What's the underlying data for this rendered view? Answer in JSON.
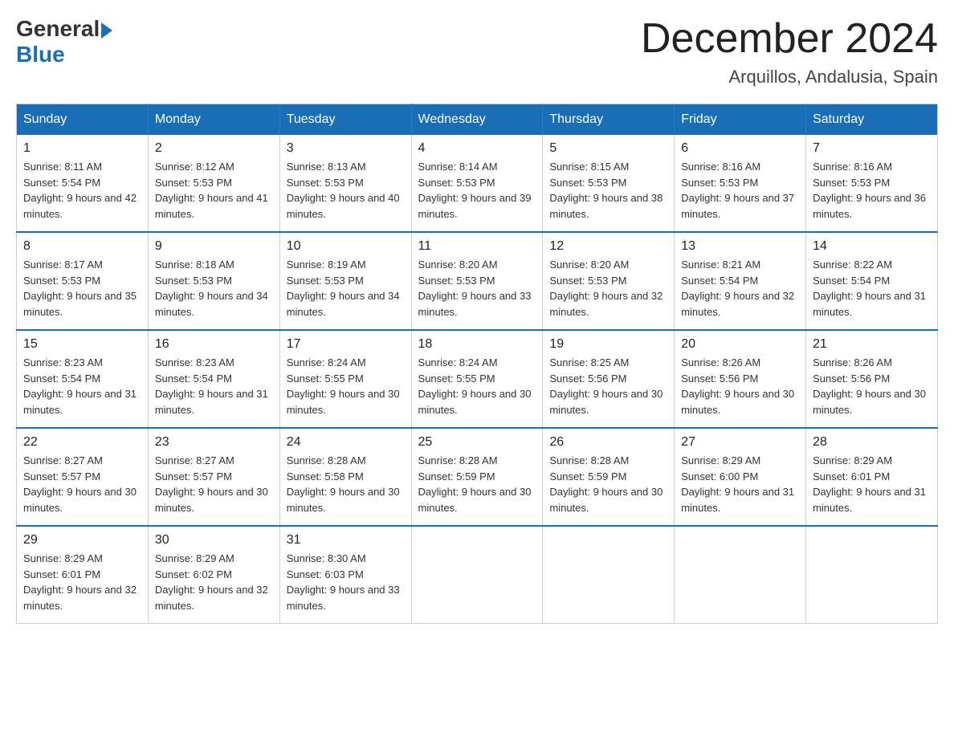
{
  "logo": {
    "general": "General",
    "blue": "Blue"
  },
  "title": {
    "month": "December 2024",
    "location": "Arquillos, Andalusia, Spain"
  },
  "weekdays": [
    "Sunday",
    "Monday",
    "Tuesday",
    "Wednesday",
    "Thursday",
    "Friday",
    "Saturday"
  ],
  "weeks": [
    [
      {
        "day": "1",
        "sunrise": "8:11 AM",
        "sunset": "5:54 PM",
        "daylight": "9 hours and 42 minutes."
      },
      {
        "day": "2",
        "sunrise": "8:12 AM",
        "sunset": "5:53 PM",
        "daylight": "9 hours and 41 minutes."
      },
      {
        "day": "3",
        "sunrise": "8:13 AM",
        "sunset": "5:53 PM",
        "daylight": "9 hours and 40 minutes."
      },
      {
        "day": "4",
        "sunrise": "8:14 AM",
        "sunset": "5:53 PM",
        "daylight": "9 hours and 39 minutes."
      },
      {
        "day": "5",
        "sunrise": "8:15 AM",
        "sunset": "5:53 PM",
        "daylight": "9 hours and 38 minutes."
      },
      {
        "day": "6",
        "sunrise": "8:16 AM",
        "sunset": "5:53 PM",
        "daylight": "9 hours and 37 minutes."
      },
      {
        "day": "7",
        "sunrise": "8:16 AM",
        "sunset": "5:53 PM",
        "daylight": "9 hours and 36 minutes."
      }
    ],
    [
      {
        "day": "8",
        "sunrise": "8:17 AM",
        "sunset": "5:53 PM",
        "daylight": "9 hours and 35 minutes."
      },
      {
        "day": "9",
        "sunrise": "8:18 AM",
        "sunset": "5:53 PM",
        "daylight": "9 hours and 34 minutes."
      },
      {
        "day": "10",
        "sunrise": "8:19 AM",
        "sunset": "5:53 PM",
        "daylight": "9 hours and 34 minutes."
      },
      {
        "day": "11",
        "sunrise": "8:20 AM",
        "sunset": "5:53 PM",
        "daylight": "9 hours and 33 minutes."
      },
      {
        "day": "12",
        "sunrise": "8:20 AM",
        "sunset": "5:53 PM",
        "daylight": "9 hours and 32 minutes."
      },
      {
        "day": "13",
        "sunrise": "8:21 AM",
        "sunset": "5:54 PM",
        "daylight": "9 hours and 32 minutes."
      },
      {
        "day": "14",
        "sunrise": "8:22 AM",
        "sunset": "5:54 PM",
        "daylight": "9 hours and 31 minutes."
      }
    ],
    [
      {
        "day": "15",
        "sunrise": "8:23 AM",
        "sunset": "5:54 PM",
        "daylight": "9 hours and 31 minutes."
      },
      {
        "day": "16",
        "sunrise": "8:23 AM",
        "sunset": "5:54 PM",
        "daylight": "9 hours and 31 minutes."
      },
      {
        "day": "17",
        "sunrise": "8:24 AM",
        "sunset": "5:55 PM",
        "daylight": "9 hours and 30 minutes."
      },
      {
        "day": "18",
        "sunrise": "8:24 AM",
        "sunset": "5:55 PM",
        "daylight": "9 hours and 30 minutes."
      },
      {
        "day": "19",
        "sunrise": "8:25 AM",
        "sunset": "5:56 PM",
        "daylight": "9 hours and 30 minutes."
      },
      {
        "day": "20",
        "sunrise": "8:26 AM",
        "sunset": "5:56 PM",
        "daylight": "9 hours and 30 minutes."
      },
      {
        "day": "21",
        "sunrise": "8:26 AM",
        "sunset": "5:56 PM",
        "daylight": "9 hours and 30 minutes."
      }
    ],
    [
      {
        "day": "22",
        "sunrise": "8:27 AM",
        "sunset": "5:57 PM",
        "daylight": "9 hours and 30 minutes."
      },
      {
        "day": "23",
        "sunrise": "8:27 AM",
        "sunset": "5:57 PM",
        "daylight": "9 hours and 30 minutes."
      },
      {
        "day": "24",
        "sunrise": "8:28 AM",
        "sunset": "5:58 PM",
        "daylight": "9 hours and 30 minutes."
      },
      {
        "day": "25",
        "sunrise": "8:28 AM",
        "sunset": "5:59 PM",
        "daylight": "9 hours and 30 minutes."
      },
      {
        "day": "26",
        "sunrise": "8:28 AM",
        "sunset": "5:59 PM",
        "daylight": "9 hours and 30 minutes."
      },
      {
        "day": "27",
        "sunrise": "8:29 AM",
        "sunset": "6:00 PM",
        "daylight": "9 hours and 31 minutes."
      },
      {
        "day": "28",
        "sunrise": "8:29 AM",
        "sunset": "6:01 PM",
        "daylight": "9 hours and 31 minutes."
      }
    ],
    [
      {
        "day": "29",
        "sunrise": "8:29 AM",
        "sunset": "6:01 PM",
        "daylight": "9 hours and 32 minutes."
      },
      {
        "day": "30",
        "sunrise": "8:29 AM",
        "sunset": "6:02 PM",
        "daylight": "9 hours and 32 minutes."
      },
      {
        "day": "31",
        "sunrise": "8:30 AM",
        "sunset": "6:03 PM",
        "daylight": "9 hours and 33 minutes."
      },
      null,
      null,
      null,
      null
    ]
  ]
}
